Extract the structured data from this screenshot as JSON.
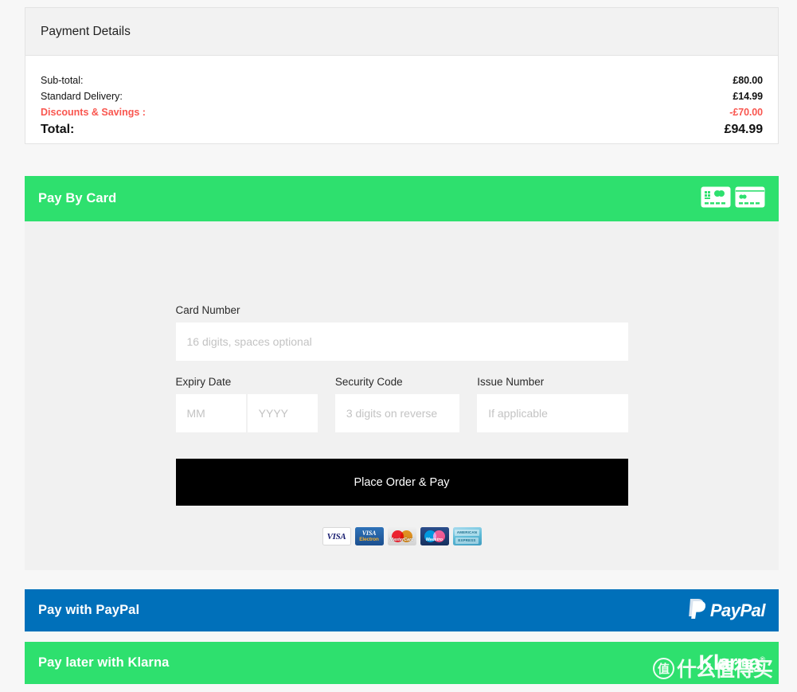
{
  "summary": {
    "title": "Payment Details",
    "rows": [
      {
        "label": "Sub-total:",
        "value": "£80.00",
        "kind": "normal"
      },
      {
        "label": "Standard Delivery:",
        "value": "£14.99",
        "kind": "normal"
      },
      {
        "label": "Discounts & Savings :",
        "value": "-£70.00",
        "kind": "discount"
      },
      {
        "label": "Total:",
        "value": "£94.99",
        "kind": "total"
      }
    ]
  },
  "card_section": {
    "title": "Pay By Card",
    "header_icons": [
      "credit-card-front-icon",
      "credit-card-back-icon"
    ],
    "fields": {
      "card_number": {
        "label": "Card Number",
        "value": "",
        "placeholder": "16 digits, spaces optional"
      },
      "expiry_month": {
        "label": "Expiry Date",
        "value": "",
        "placeholder": "MM"
      },
      "expiry_year": {
        "value": "",
        "placeholder": "YYYY"
      },
      "security_code": {
        "label": "Security Code",
        "value": "",
        "placeholder": "3 digits on reverse"
      },
      "issue_number": {
        "label": "Issue Number",
        "value": "",
        "placeholder": "If applicable"
      }
    },
    "submit_label": "Place Order & Pay",
    "accepted_cards": [
      {
        "name": "visa",
        "text": "VISA"
      },
      {
        "name": "visa-electron",
        "line1": "VISA",
        "line2": "Electron"
      },
      {
        "name": "mastercard",
        "text": "MasterCard"
      },
      {
        "name": "maestro",
        "text": "Maestro"
      },
      {
        "name": "american-express",
        "line1": "AMERICAN",
        "line2": "EXPRESS"
      }
    ]
  },
  "paypal_section": {
    "title": "Pay with PayPal",
    "logo_text": "PayPal"
  },
  "klarna_section": {
    "title": "Pay later with Klarna",
    "logo_text": "Klarna",
    "logo_mark": "®"
  },
  "watermark": {
    "mark": "值",
    "text": "什么值得买"
  },
  "colors": {
    "green": "#2ee06e",
    "paypal_blue": "#0070ba",
    "discount_red": "#f9564f",
    "button_black": "#000000",
    "body_grey": "#f1f1f1"
  }
}
